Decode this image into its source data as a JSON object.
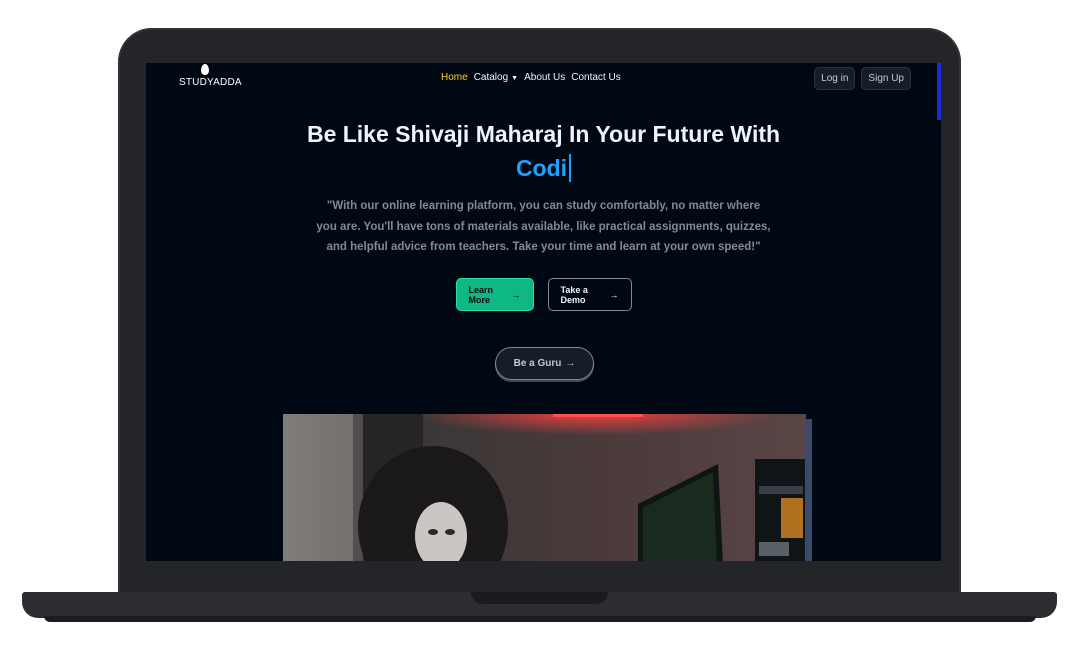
{
  "nav": {
    "logo_text": "STUDYADDA",
    "links": [
      {
        "label": "Home",
        "active": true
      },
      {
        "label": "Catalog",
        "dropdown": true
      },
      {
        "label": "About Us"
      },
      {
        "label": "Contact Us"
      }
    ],
    "login": "Log in",
    "signup": "Sign Up"
  },
  "hero": {
    "title": "Be Like Shivaji Maharaj In Your Future With",
    "typed": "Codi",
    "description": "\"With our online learning platform, you can study comfortably, no matter where you are. You'll have tons of materials available, like practical assignments, quizzes, and helpful advice from teachers. Take your time and learn at your own speed!\"",
    "learn_more": "Learn More",
    "take_demo": "Take a Demo",
    "be_guru": "Be a Guru"
  },
  "colors": {
    "background": "#000814",
    "accent_yellow": "#ffd60a",
    "accent_blue": "#1fa2ff",
    "primary_green": "#0fb782"
  },
  "icons": {
    "arrow": "arrow-right-icon",
    "caret": "chevron-down-icon"
  }
}
